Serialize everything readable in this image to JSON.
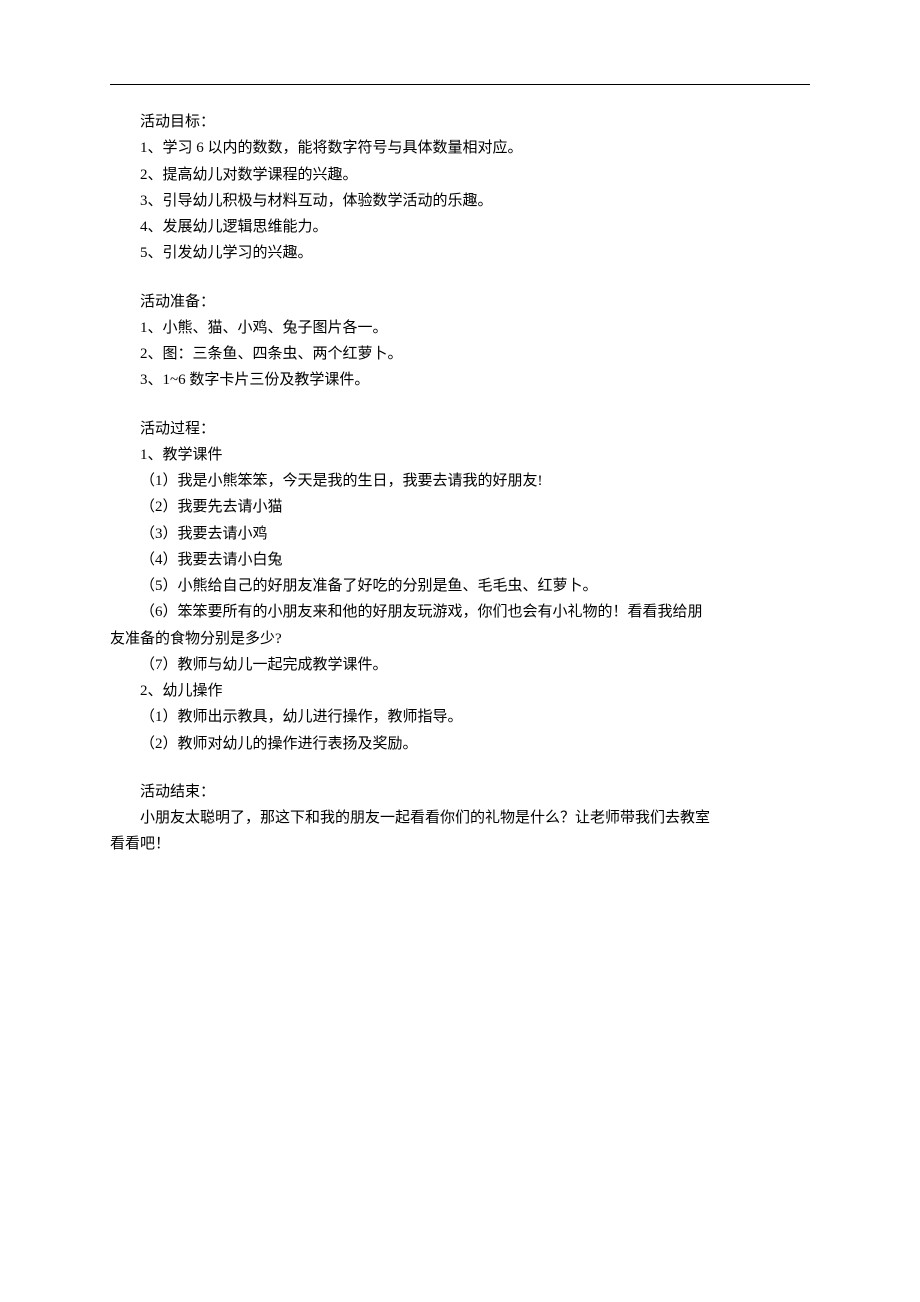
{
  "section1": {
    "title": "活动目标：",
    "items": [
      "1、学习 6 以内的数数，能将数字符号与具体数量相对应。",
      "2、提高幼儿对数学课程的兴趣。",
      "3、引导幼儿积极与材料互动，体验数学活动的乐趣。",
      "4、发展幼儿逻辑思维能力。",
      "5、引发幼儿学习的兴趣。"
    ]
  },
  "section2": {
    "title": "活动准备：",
    "items": [
      "1、小熊、猫、小鸡、兔子图片各一。",
      "2、图：三条鱼、四条虫、两个红萝卜。",
      "3、1~6 数字卡片三份及教学课件。"
    ]
  },
  "section3": {
    "title": "活动过程：",
    "group1_title": "1、教学课件",
    "group1_items": [
      "（1）我是小熊笨笨，今天是我的生日，我要去请我的好朋友!",
      "（2）我要先去请小猫",
      "（3）我要去请小鸡",
      "（4）我要去请小白兔",
      "（5）小熊给自己的好朋友准备了好吃的分别是鱼、毛毛虫、红萝卜。"
    ],
    "group1_item6_part1": "（6）笨笨要所有的小朋友来和他的好朋友玩游戏，你们也会有小礼物的！看看我给朋",
    "group1_item6_part2": "友准备的食物分别是多少?",
    "group1_item7": "（7）教师与幼儿一起完成教学课件。",
    "group2_title": "2、幼儿操作",
    "group2_items": [
      "（1）教师出示教具，幼儿进行操作，教师指导。",
      "（2）教师对幼儿的操作进行表扬及奖励。"
    ]
  },
  "section4": {
    "title": "活动结束：",
    "text_part1": "小朋友太聪明了，那这下和我的朋友一起看看你们的礼物是什么？让老师带我们去教室",
    "text_part2": "看看吧！"
  }
}
